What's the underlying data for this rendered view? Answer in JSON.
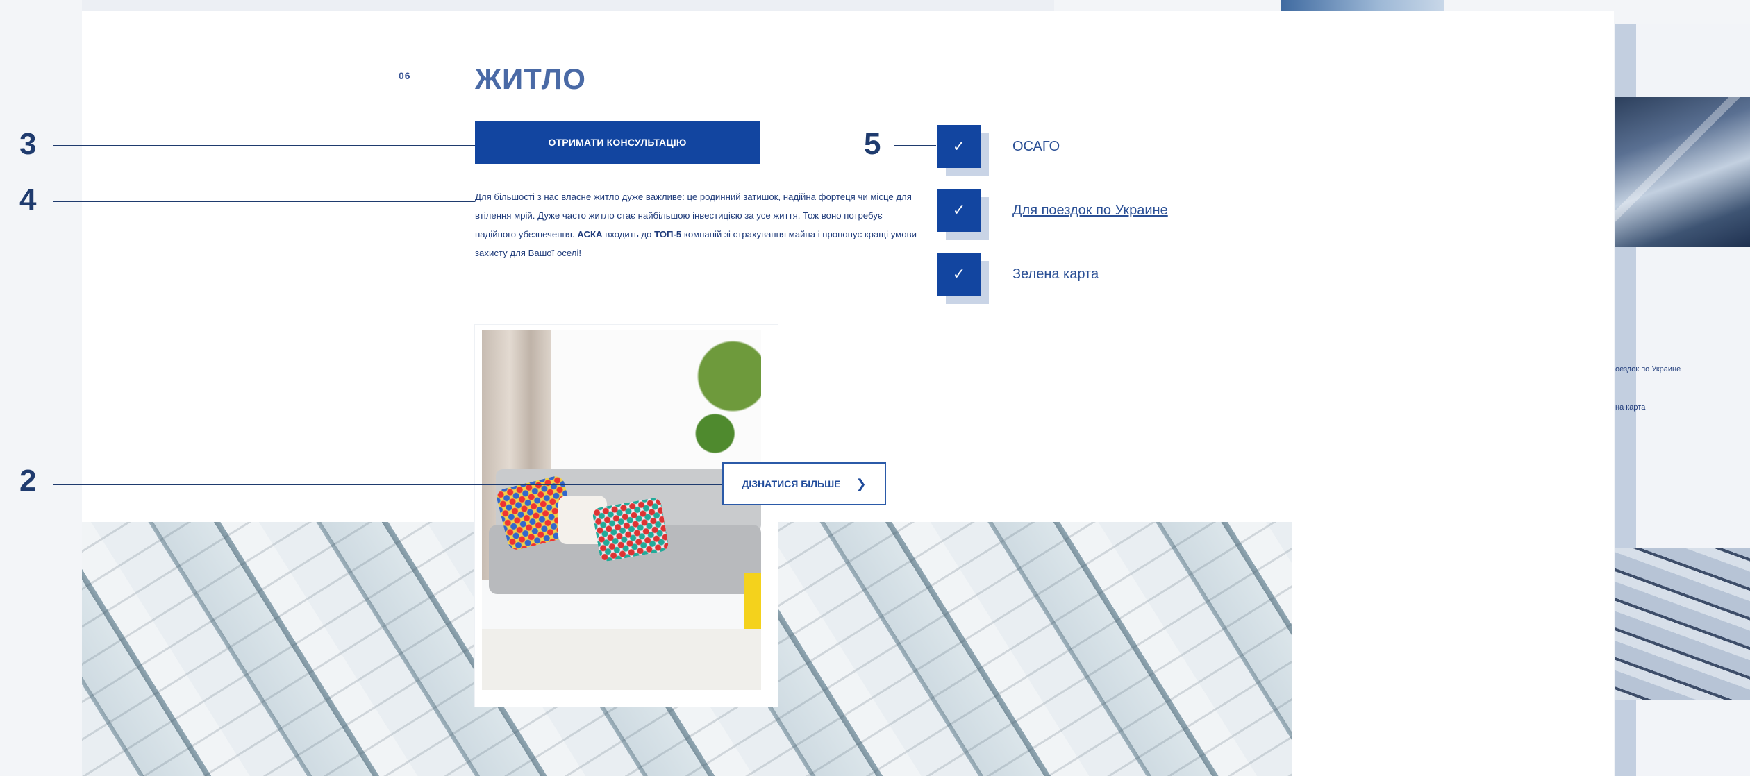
{
  "section": {
    "number": "06",
    "title": "ЖИТЛО",
    "cta_label": "ОТРИМАТИ КОНСУЛЬТАЦІЮ",
    "description_parts": [
      "Для більшості з нас власне житло дуже важливе: це родинний затишок, надійна фортеця чи місце для втілення мрій. Дуже часто житло стає найбільшою інвестицією за усе життя. Тож воно потребує надійного убезпечення. ",
      "АСКА",
      " входить до ",
      "ТОП-5",
      " компаній зі страхування майна і пропонує кращі умови захисту для Вашої оселі!"
    ],
    "learn_more_label": "ДІЗНАТИСЯ БІЛЬШЕ",
    "learn_more_icon": "chevron-right-icon"
  },
  "checklist": [
    {
      "label": "ОСАГО",
      "icon": "check-icon",
      "link": false
    },
    {
      "label": "Для поездок по Украине",
      "icon": "check-icon",
      "link": true
    },
    {
      "label": "Зелена карта",
      "icon": "check-icon",
      "link": false
    }
  ],
  "callouts": [
    "3",
    "4",
    "2",
    "5"
  ],
  "right_preview": {
    "text1": "оездок по Украине",
    "text2": "на карта"
  },
  "colors": {
    "primary": "#1245a0",
    "heading": "#4a6aa6",
    "callout": "#1f3b6e",
    "check_shadow": "#c9d4e6"
  }
}
